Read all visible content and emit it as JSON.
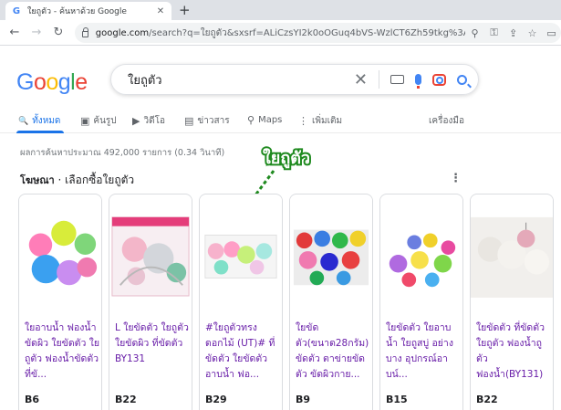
{
  "browser": {
    "tab_title": "ใยถูตัว - ค้นหาด้วย Google",
    "tab_favicon": "G",
    "close_glyph": "✕",
    "new_tab_glyph": "+",
    "url_host": "google.com",
    "url_rest": "/search?q=ใยถูตัว&sxsrf=ALiCzsYI2k0oOGuq4bVS-WzlCT6Zh59tkg%3A1670683..."
  },
  "search": {
    "query": "ใยถูตัว",
    "clear_glyph": "✕"
  },
  "nav_tabs": [
    {
      "label": "ทั้งหมด",
      "icon": "search-icon",
      "glyph": "🔍"
    },
    {
      "label": "ค้นรูป",
      "icon": "image-icon",
      "glyph": "▣"
    },
    {
      "label": "วิดีโอ",
      "icon": "video-icon",
      "glyph": "▶"
    },
    {
      "label": "ข่าวสาร",
      "icon": "news-icon",
      "glyph": "▤"
    },
    {
      "label": "Maps",
      "icon": "map-pin-icon",
      "glyph": "⚲"
    },
    {
      "label": "เพิ่มเติม",
      "icon": "more-vertical-icon",
      "glyph": "⋮"
    },
    {
      "label": "เครื่องมือ",
      "icon": "",
      "glyph": ""
    }
  ],
  "result_stats": "ผลการค้นหาประมาณ 492,000 รายการ (0.34 วินาที)",
  "annotation": "ใยถูตัว",
  "shopping": {
    "ad_label": "โฆษณา",
    "separator": " · ",
    "heading": "เลือกซื้อใยถูตัว",
    "more_glyph": "⋮",
    "products": [
      {
        "title": "ใยอาบน้ำ ฟองน้ำขัดผิว ใยขัดตัว ใยถูตัว ฟองน้ำขัดตัว ที่ขั...",
        "price": "B6"
      },
      {
        "title": "L ใยขัดตัว ใยถูตัว ใยขัดผิว ที่ขัดตัว BY131",
        "price": "B22"
      },
      {
        "title": "#ใยถูตัวทรงดอกไม้ (UT)# ที่ขัดตัว ใยขัดตัวอาบน้ำ ฟอ...",
        "price": "B29"
      },
      {
        "title": "ใยขัดตัว(ขนาด28กรัม) ขัดตัว ตาข่ายขัดตัว ขัดผิวกาย...",
        "price": "B9"
      },
      {
        "title": "ใยขัดตัว ใยอาบน้ำ ใยถูสบู่ อย่างบาง อุปกรณ์อาบน์...",
        "price": "B15"
      },
      {
        "title": "ใยขัดตัว ที่ขัดตัว ใยถูตัว ฟองน้ำถูตัว ฟองน้ำ(BY131)",
        "price": "B22"
      }
    ]
  },
  "colors": {
    "google_blue": "#4285f4",
    "google_red": "#ea4335",
    "google_yellow": "#fbbc05",
    "google_green": "#34a853",
    "link_purple": "#681da8",
    "active_tab": "#1a73e8",
    "annotation_green": "#1f8a1f"
  }
}
